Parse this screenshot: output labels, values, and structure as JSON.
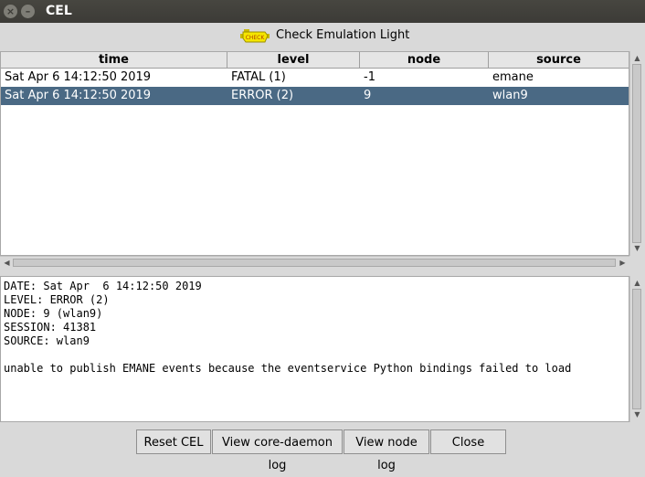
{
  "window": {
    "title": "CEL"
  },
  "header": {
    "title": "Check Emulation Light",
    "icon_text": "CHECK",
    "icon_color": "#f5e600"
  },
  "table": {
    "columns": [
      "time",
      "level",
      "node",
      "source"
    ],
    "rows": [
      {
        "time": "Sat Apr  6 14:12:50 2019",
        "level": "FATAL (1)",
        "node": "-1",
        "source": "emane"
      },
      {
        "time": "Sat Apr  6 14:12:50 2019",
        "level": "ERROR (2)",
        "node": "9",
        "source": "wlan9"
      }
    ],
    "selected_row": 1
  },
  "detail": {
    "date": "DATE: Sat Apr  6 14:12:50 2019",
    "level": "LEVEL: ERROR (2)",
    "node": "NODE: 9 (wlan9)",
    "session": "SESSION: 41381",
    "source": "SOURCE: wlan9",
    "message": "unable to publish EMANE events because the eventservice Python bindings failed to load"
  },
  "buttons": {
    "reset": "Reset CEL",
    "daemon_log": "View core-daemon log",
    "node_log": "View node log",
    "close": "Close"
  },
  "colors": {
    "selection": "#4a6984",
    "titlebar": "#3c3b37"
  }
}
